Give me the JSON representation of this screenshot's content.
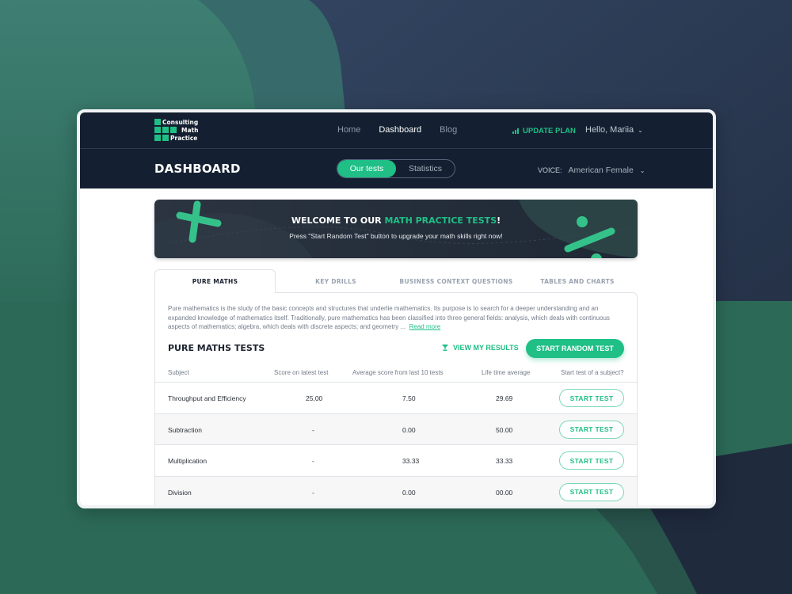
{
  "colors": {
    "accent": "#1fbf86",
    "nav_bg": "#142031",
    "backdrop": "#344661",
    "backdrop_green": "#2e6b5c"
  },
  "logo": {
    "lines": [
      "Consulting",
      "Math",
      "Practice"
    ]
  },
  "nav": {
    "items": [
      {
        "label": "Home",
        "active": false
      },
      {
        "label": "Dashboard",
        "active": true
      },
      {
        "label": "Blog",
        "active": false
      }
    ],
    "update_plan": "UPDATE PLAN",
    "update_plan_icon": "signal-bars-icon",
    "greeting": "Hello, Mariia",
    "greeting_icon": "chevron-down-icon"
  },
  "dashboard": {
    "title": "DASHBOARD",
    "segments": [
      {
        "label": "Our tests",
        "active": true
      },
      {
        "label": "Statistics",
        "active": false
      }
    ],
    "voice_label": "VOICE:",
    "voice_value": "American Female"
  },
  "banner": {
    "title_prefix": "WELCOME TO OUR ",
    "title_highlight": "MATH PRACTICE TESTS",
    "title_suffix": "!",
    "subtitle": "Press \"Start Random Test\" button to upgrade your math skills right now!",
    "decor_icons": [
      "plus-icon",
      "divide-icon"
    ]
  },
  "tabs": [
    {
      "label": "PURE MATHS",
      "active": true
    },
    {
      "label": "KEY DRILLS",
      "active": false
    },
    {
      "label": "BUSINESS CONTEXT QUESTIONS",
      "active": false
    },
    {
      "label": "TABLES AND CHARTS",
      "active": false
    }
  ],
  "panel": {
    "description": "Pure mathematics is the study of the basic concepts and structures that underlie mathematics. Its purpose is to search for a deeper understanding and an expanded knowledge of mathematics itself. Traditionally, pure mathematics has been classified into three general fields: analysis, which deals with continuous aspects of mathematics; algebra, which deals with discrete aspects; and geometry ...",
    "read_more": "Read more",
    "tests_title": "PURE MATHS TESTS",
    "view_results": "VIEW MY RESULTS",
    "view_results_icon": "trophy-icon",
    "random_button": "START RANDOM TEST"
  },
  "table": {
    "headers": [
      "Subject",
      "Score on latest test",
      "Average score from last 10 tests",
      "Life time average",
      "Start test of a subject?"
    ],
    "rows": [
      {
        "subject": "Throughput and Efficiency",
        "latest": "25,00",
        "avg10": "7.50",
        "lifetime": "29.69",
        "action": "START TEST"
      },
      {
        "subject": "Subtraction",
        "latest": "-",
        "avg10": "0.00",
        "lifetime": "50.00",
        "action": "START TEST"
      },
      {
        "subject": "Multiplication",
        "latest": "-",
        "avg10": "33.33",
        "lifetime": "33.33",
        "action": "START TEST"
      },
      {
        "subject": "Division",
        "latest": "-",
        "avg10": "0.00",
        "lifetime": "00.00",
        "action": "START TEST"
      }
    ]
  }
}
